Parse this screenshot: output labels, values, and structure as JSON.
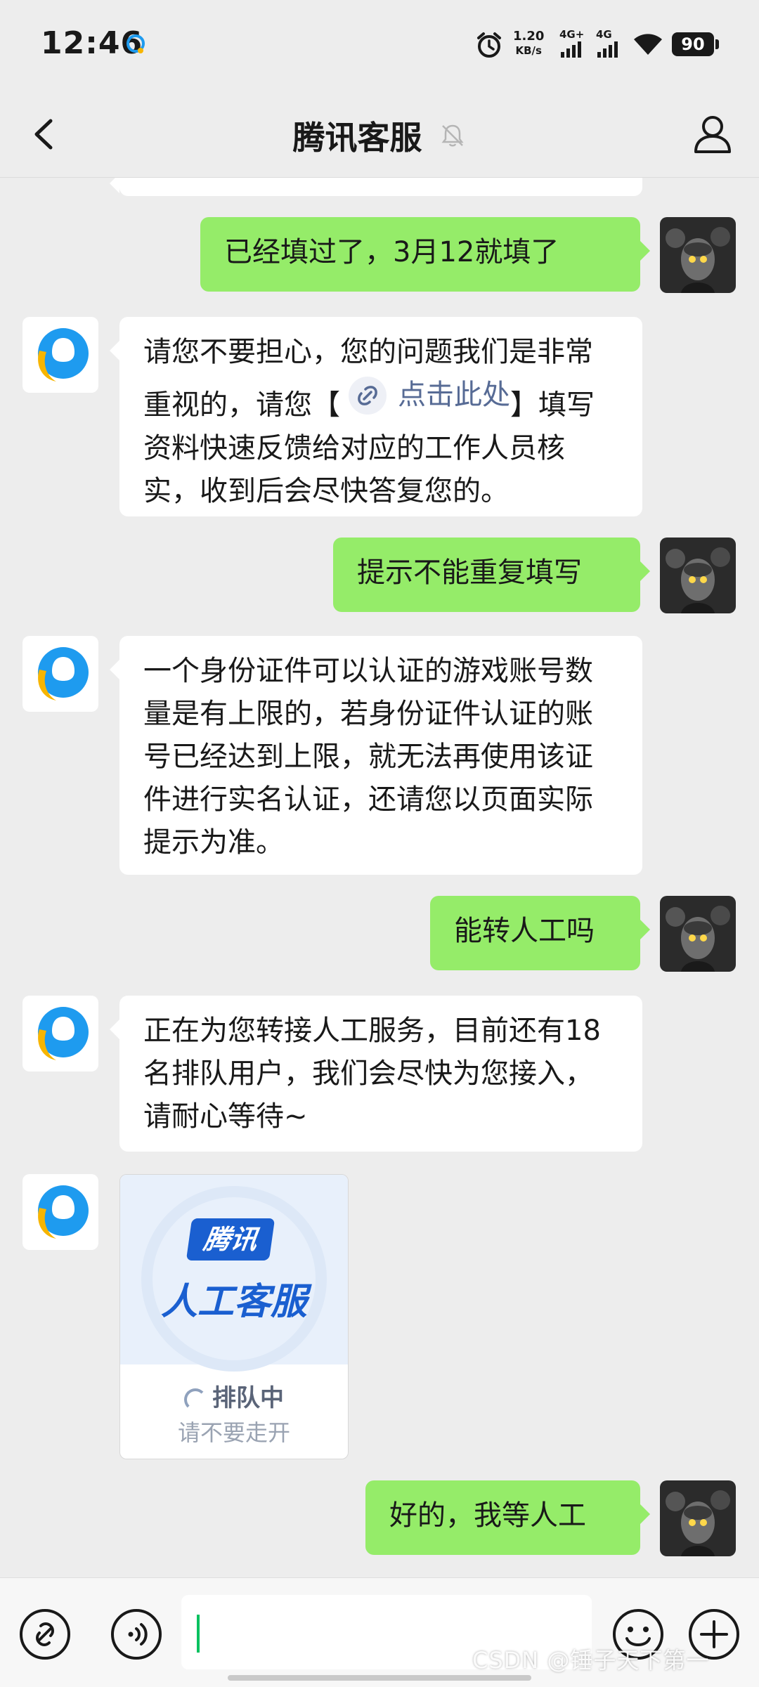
{
  "status_bar": {
    "time": "12:46",
    "speed_value": "1.20",
    "speed_unit": "KB/s",
    "signal1_label": "4G+",
    "signal2_label": "4G",
    "battery": "90"
  },
  "header": {
    "title": "腾讯客服"
  },
  "messages": [
    {
      "side": "out",
      "text": "已经填过了，3月12就填了"
    },
    {
      "side": "in",
      "text_before": "请您不要担心，您的问题我们是非常重视的，请您【",
      "link": "点击此处",
      "text_after": "】填写资料快速反馈给对应的工作人员核实，收到后会尽快答复您的。"
    },
    {
      "side": "out",
      "text": "提示不能重复填写"
    },
    {
      "side": "in",
      "text": "一个身份证件可以认证的游戏账号数量是有上限的，若身份证件认证的账号已经达到上限，就无法再使用该证件进行实名认证，还请您以页面实际提示为准。"
    },
    {
      "side": "out",
      "text": "能转人工吗"
    },
    {
      "side": "in",
      "text": "正在为您转接人工服务，目前还有18名排队用户，我们会尽快为您接入，请耐心等待~"
    },
    {
      "side": "in",
      "type": "image",
      "brand": "腾讯",
      "heading": "人工客服",
      "status": "排队中",
      "hint": "请不要走开"
    },
    {
      "side": "out",
      "text": "好的，我等人工"
    }
  ],
  "input_bar": {
    "value": ""
  },
  "watermark": "CSDN @锤子天下第一",
  "colors": {
    "outgoing_bubble": "#95ec69",
    "incoming_bubble": "#ffffff",
    "background": "#ededed",
    "link": "#576b95",
    "qq_blue": "#1e9bef",
    "qq_yellow": "#f7b500"
  }
}
